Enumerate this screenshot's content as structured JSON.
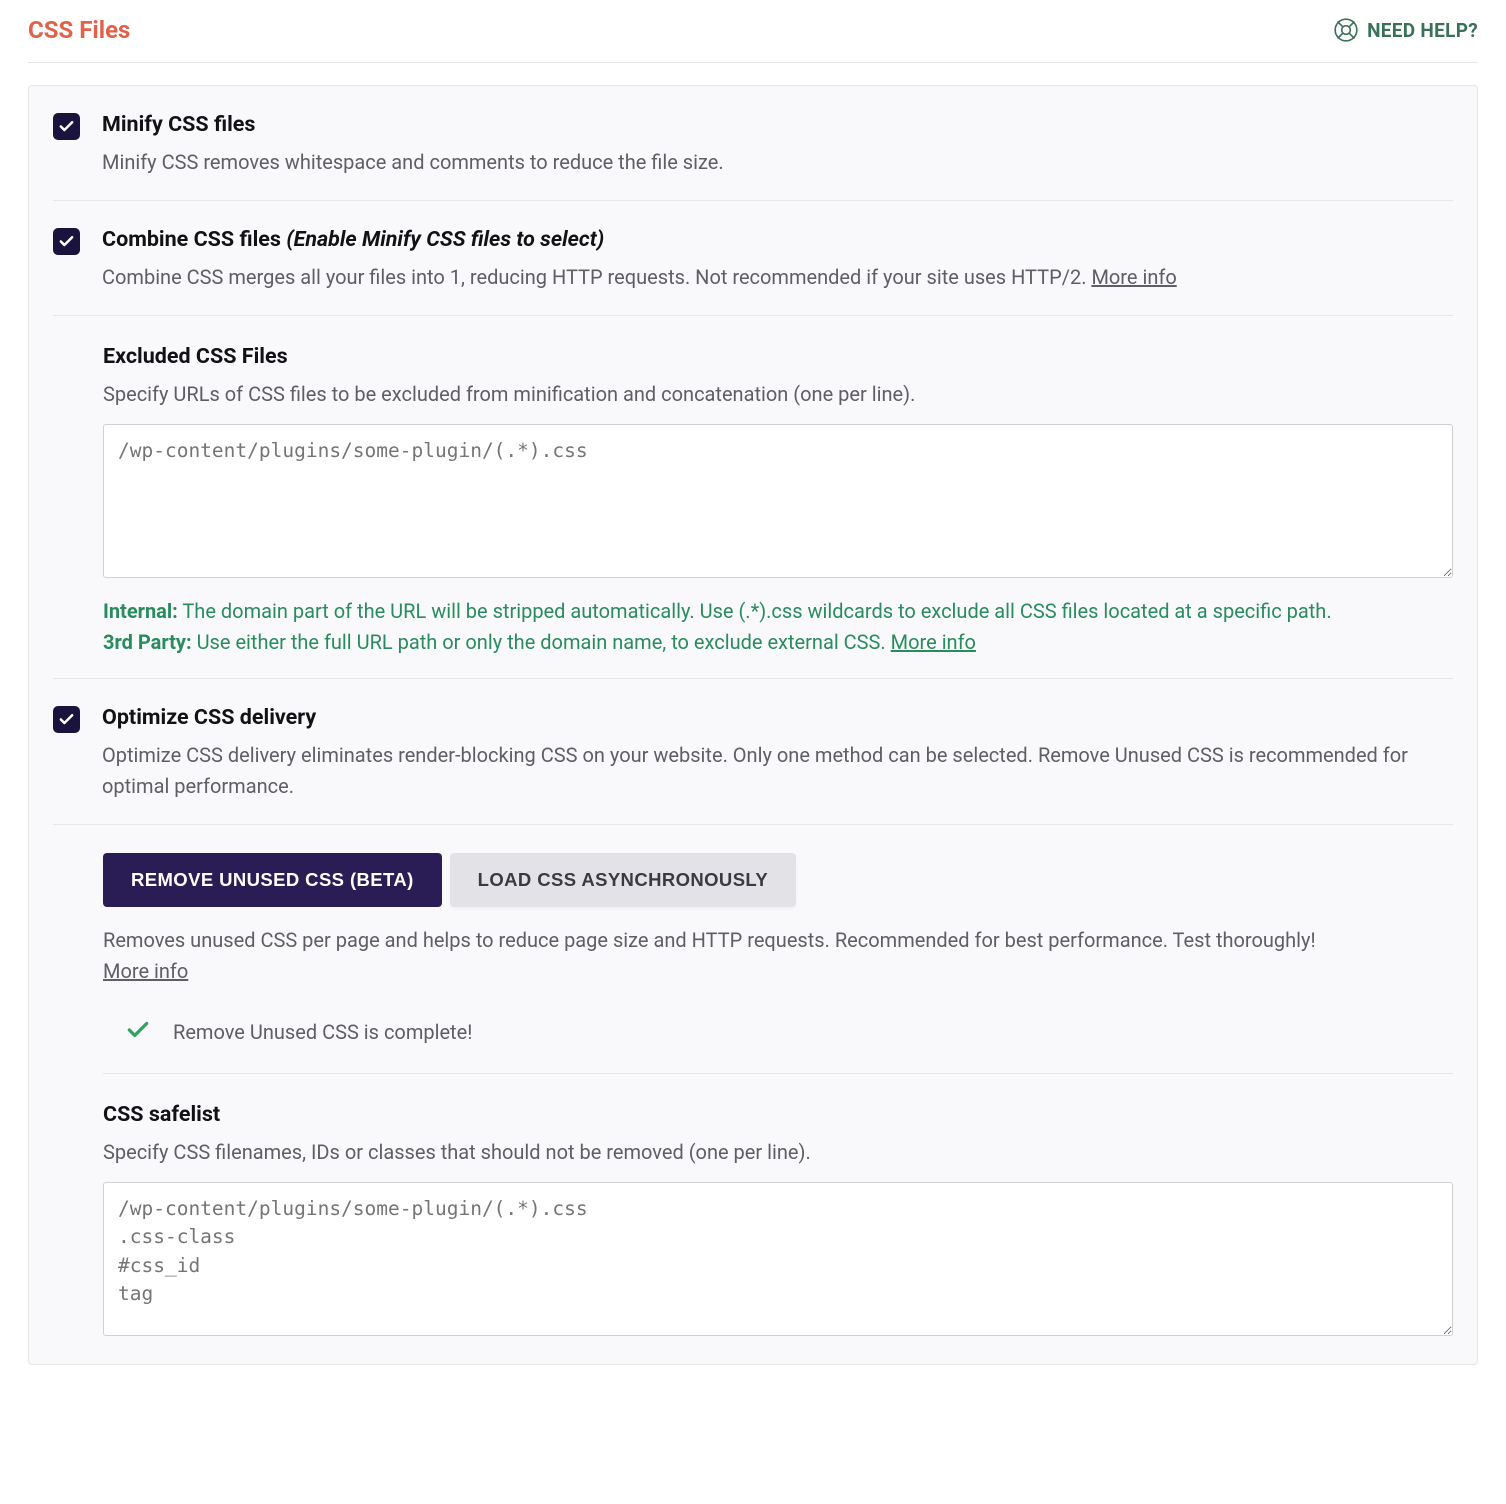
{
  "header": {
    "title": "CSS Files",
    "help_label": "NEED HELP?"
  },
  "options": {
    "minify": {
      "title": "Minify CSS files",
      "desc": "Minify CSS removes whitespace and comments to reduce the file size."
    },
    "combine": {
      "title": "Combine CSS files",
      "title_note": "(Enable Minify CSS files to select)",
      "desc": "Combine CSS merges all your files into 1, reducing HTTP requests. Not recommended if your site uses HTTP/2.",
      "more_info": "More info"
    },
    "excluded": {
      "title": "Excluded CSS Files",
      "desc": "Specify URLs of CSS files to be excluded from minification and concatenation (one per line).",
      "placeholder": "/wp-content/plugins/some-plugin/(.*).css",
      "hint_internal_lead": "Internal:",
      "hint_internal_text": " The domain part of the URL will be stripped automatically. Use (.*).css wildcards to exclude all CSS files located at a specific path.",
      "hint_thirdparty_lead": "3rd Party:",
      "hint_thirdparty_text": " Use either the full URL path or only the domain name, to exclude external CSS. ",
      "more_info": "More info"
    },
    "optimize": {
      "title": "Optimize CSS delivery",
      "desc": "Optimize CSS delivery eliminates render-blocking CSS on your website. Only one method can be selected. Remove Unused CSS is recommended for optimal performance."
    },
    "delivery": {
      "tab_remove": "REMOVE UNUSED CSS (BETA)",
      "tab_async": "LOAD CSS ASYNCHRONOUSLY",
      "desc": "Removes unused CSS per page and helps to reduce page size and HTTP requests. Recommended for best performance. Test thoroughly!",
      "more_info": "More info",
      "status_text": "Remove Unused CSS is complete!"
    },
    "safelist": {
      "title": "CSS safelist",
      "desc": "Specify CSS filenames, IDs or classes that should not be removed (one per line).",
      "placeholder": "/wp-content/plugins/some-plugin/(.*).css\n.css-class\n#css_id\ntag"
    }
  }
}
